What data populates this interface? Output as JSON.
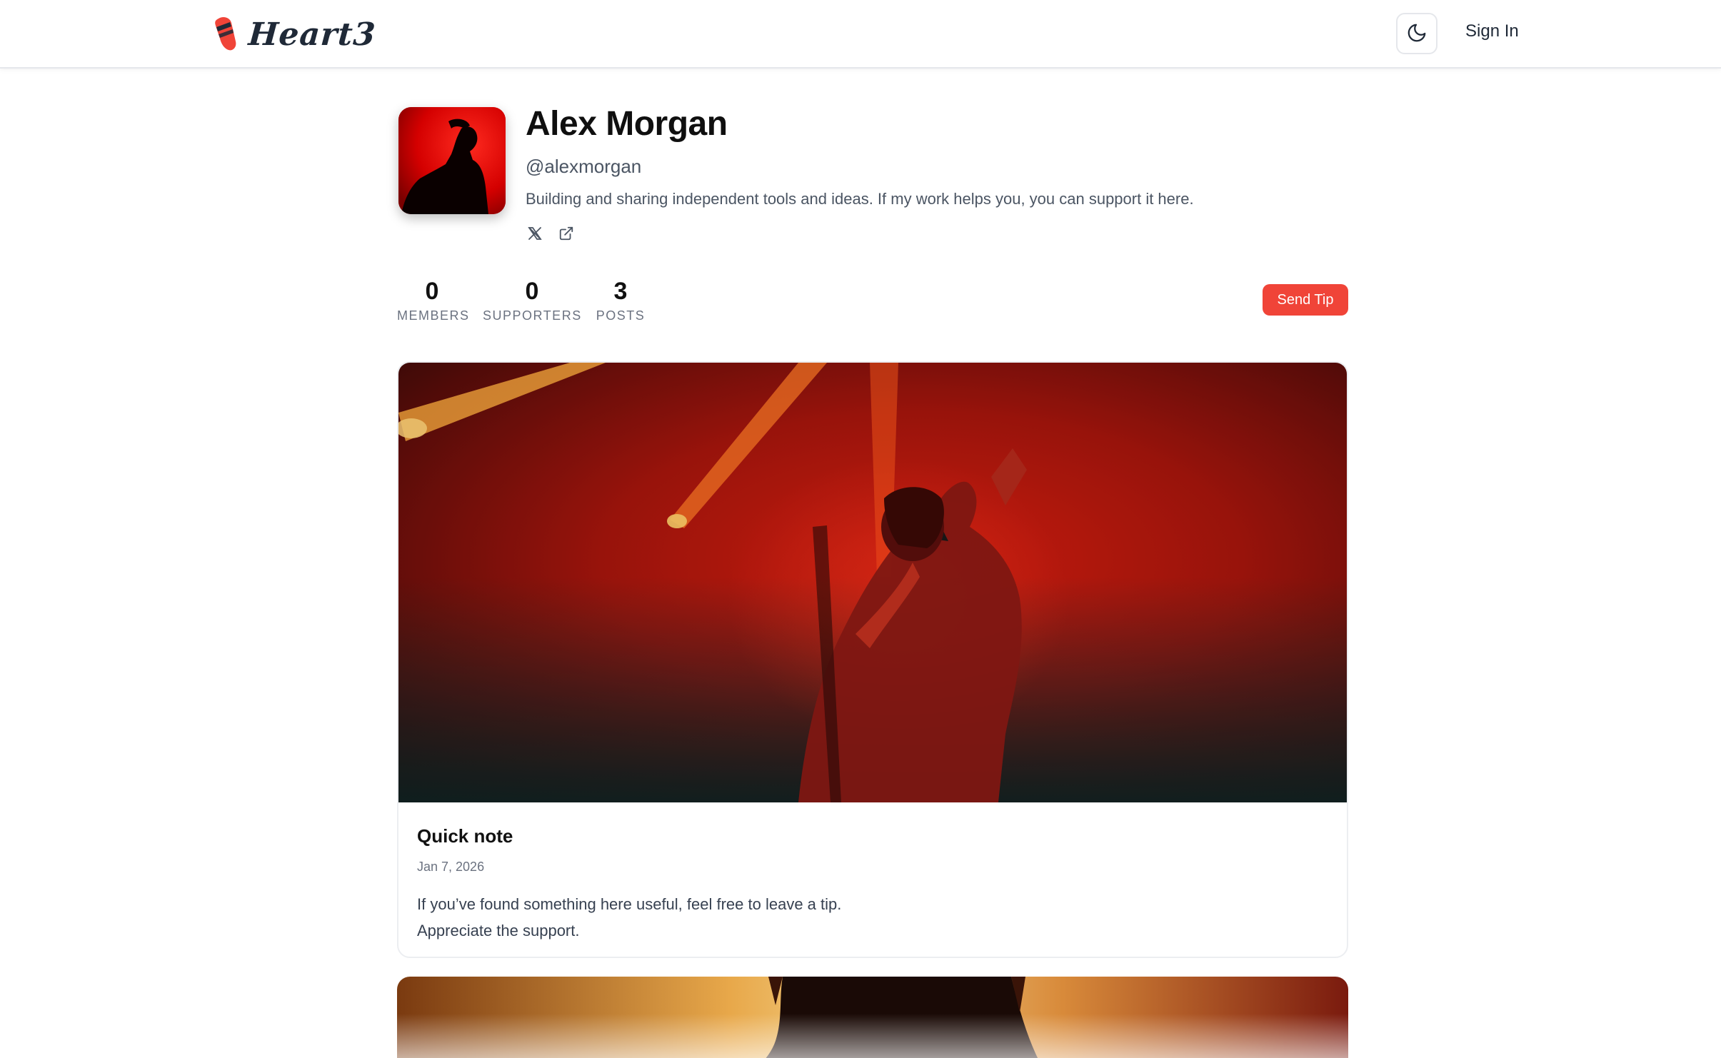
{
  "header": {
    "logo_text": "Heart3",
    "theme_icon": "moon-icon",
    "signin_label": "Sign In"
  },
  "profile": {
    "name": "Alex Morgan",
    "handle": "@alexmorgan",
    "bio": "Building and sharing independent tools and ideas. If my work helps you, you can support it here.",
    "social_icons": [
      "x-icon",
      "external-link-icon"
    ]
  },
  "stats": [
    {
      "value": "0",
      "label": "MEMBERS"
    },
    {
      "value": "0",
      "label": "SUPPORTERS"
    },
    {
      "value": "3",
      "label": "POSTS"
    }
  ],
  "actions": {
    "tip_label": "Send Tip"
  },
  "posts": [
    {
      "title": "Quick note",
      "date": "Jan 7, 2026",
      "body_line1": "If you’ve found something here useful, feel free to leave a tip.",
      "body_line2": "Appreciate the support."
    }
  ],
  "colors": {
    "accent": "#f04438",
    "text_primary": "#111827",
    "text_secondary": "#4b5563",
    "border": "#e5e7eb"
  }
}
